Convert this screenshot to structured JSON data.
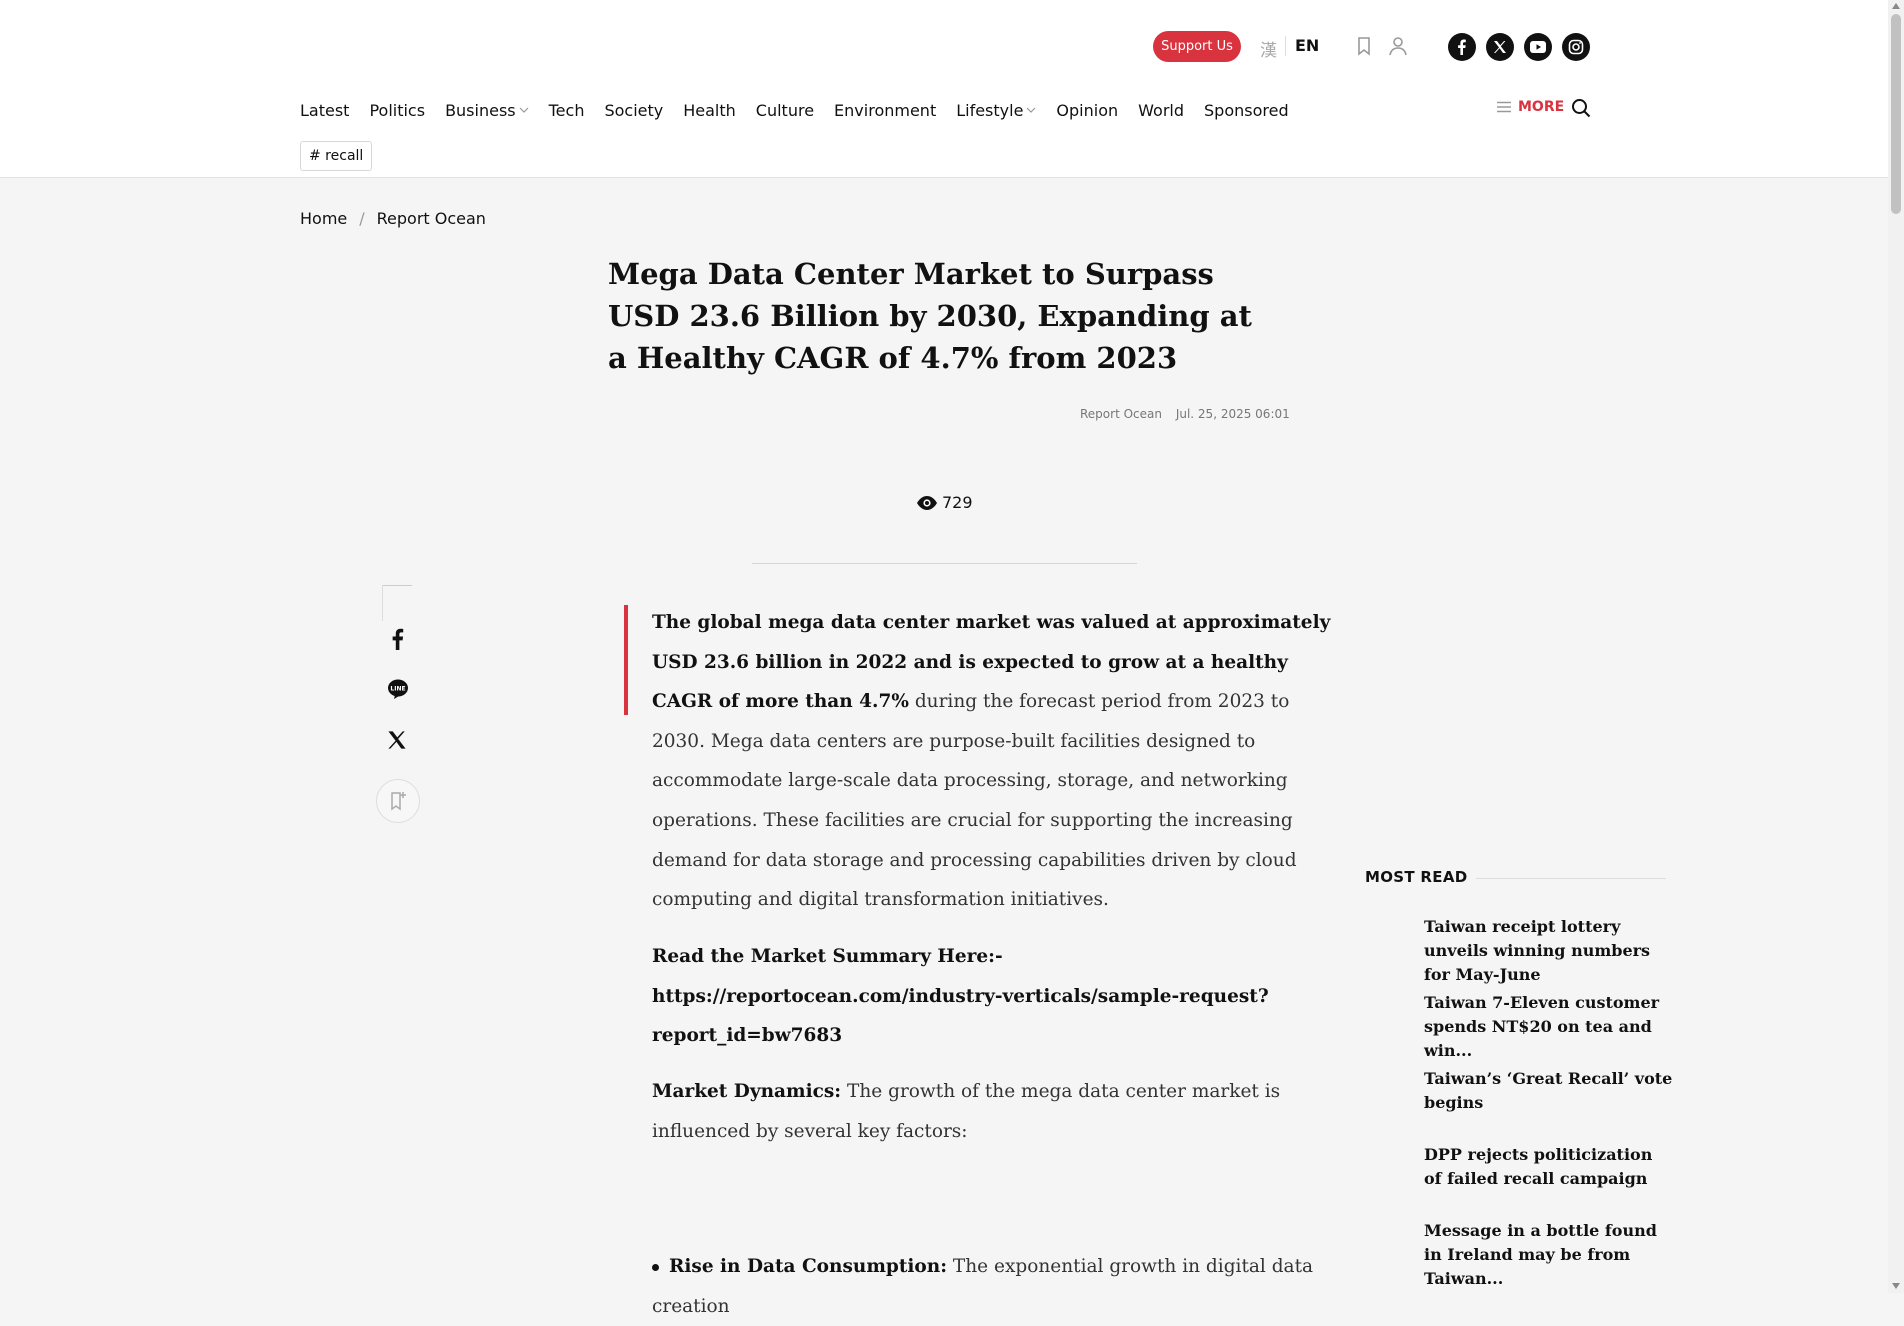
{
  "header": {
    "support_label": "Support Us",
    "lang_zh": "漢",
    "lang_en": "EN",
    "icons": [
      "bookmark-icon",
      "user-icon"
    ],
    "social": [
      "facebook-icon",
      "x-icon",
      "youtube-icon",
      "instagram-icon"
    ]
  },
  "nav": {
    "items": [
      "Latest",
      "Politics",
      "Business",
      "Tech",
      "Society",
      "Health",
      "Culture",
      "Environment",
      "Lifestyle",
      "Opinion",
      "World",
      "Sponsored"
    ],
    "more_label": "MORE",
    "tag": "# recall"
  },
  "breadcrumb": {
    "home": "Home",
    "current": "Report Ocean"
  },
  "article": {
    "headline": "Mega Data Center Market to Surpass USD 23.6 Billion by 2030, Expanding at a Healthy CAGR of 4.7% from 2023",
    "author": "Report Ocean",
    "date": "Jul. 25, 2025 06:01",
    "views": "729",
    "lead_bold": "The global mega data center market was valued at approximately USD 23.6 billion in 2022 and is expected to grow at a healthy CAGR of more than 4.7%",
    "lead_rest": " during the forecast period from 2023 to 2030. Mega data centers are purpose-built facilities designed to accommodate large-scale data processing, storage, and networking operations. These facilities are crucial for supporting the increasing demand for data storage and processing capabilities driven by cloud computing and digital transformation initiatives.",
    "summary_link": "Read the Market Summary Here:-https://reportocean.com/industry-verticals/sample-request?report_id=bw7683",
    "dynamics_bold": "Market Dynamics:",
    "dynamics_rest": " The growth of the mega data center market is influenced by several key factors:",
    "bullet1_bold": "Rise in Data Consumption:",
    "bullet1_rest": " The exponential growth in digital data creation"
  },
  "most_read": {
    "title": "MOST READ",
    "items": [
      "Taiwan receipt lottery unveils winning numbers for May-June",
      "Taiwan 7-Eleven customer spends NT$20 on tea and win...",
      "Taiwan’s ‘Great Recall’ vote begins",
      "DPP rejects politicization of failed recall campaign",
      "Message in a bottle found in Ireland may be from Taiwan..."
    ]
  },
  "colors": {
    "accent": "#d9333f",
    "background": "#f5f5f5",
    "text": "#111111"
  }
}
